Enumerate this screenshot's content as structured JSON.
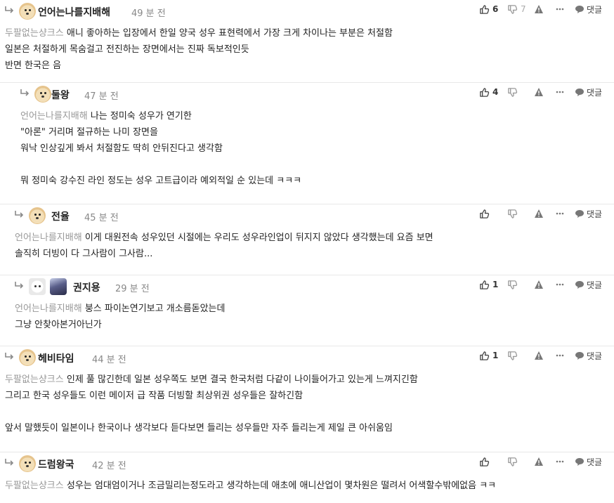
{
  "comments": [
    {
      "nickname": "언어는나를지배해",
      "time": "49 분 전",
      "likes": "6",
      "dislikes": "7",
      "mention": "두팔없는샹크스",
      "lines": [
        "애니 좋아하는 입장에서 한일 양국 성우 표현력에서 가장 크게 차이나는 부분은 처절함",
        "일본은 처절하게 목숨걸고 전진하는 장면에서는 진짜 독보적인듯",
        "반면 한국은 음"
      ]
    },
    {
      "nickname": "둘왕",
      "time": "47 분 전",
      "likes": "4",
      "dislikes": "",
      "mention": "언어는나를지배해",
      "lines": [
        "나는 정미숙 성우가 연기한",
        "\"아론\" 거리며 절규하는 나미 장면을",
        "워낙 인상깊게 봐서 처절함도 딱히 안뒤진다고 생각함",
        "",
        "뭐 정미숙 강수진 라인 정도는 성우 고트급이라 예외적일 순 있는데 ㅋㅋㅋ"
      ]
    },
    {
      "nickname": "전율",
      "time": "45 분 전",
      "likes": "",
      "dislikes": "",
      "mention": "언어는나를지배해",
      "lines": [
        "이게 대원전속 성우있던 시절에는 우리도 성우라인업이 뒤지지 않았다 생각했는데 요즘 보면",
        "솔직히 더빙이 다 그사람이 그사람..."
      ]
    },
    {
      "nickname": "권지용",
      "time": "29 분 전",
      "likes": "1",
      "dislikes": "",
      "mention": "언어는나를지배해",
      "lines": [
        "붕스 파이논연기보고 개소름돋았는데",
        "그냥 안찾아본거아닌가"
      ]
    },
    {
      "nickname": "헤비타임",
      "time": "44 분 전",
      "likes": "1",
      "dislikes": "",
      "mention": "두팔없는샹크스",
      "lines": [
        "인제 풀 많긴한데 일본 성우쪽도 보면 결국 한국처럼 다같이 나이들어가고 있는게 느껴지긴함",
        "그리고 한국 성우들도 이런 메이저 급 작품 더빙할 최상위권 성우들은 잘하긴함",
        "",
        "앞서 말했듯이 일본이나 한국이나 생각보다 듣다보면 들리는 성우들만 자주 들리는게 제일 큰 아쉬움임"
      ]
    },
    {
      "nickname": "드럼왕국",
      "time": "42 분 전",
      "likes": "",
      "dislikes": "",
      "mention": "두팔없는샹크스",
      "lines": [
        "성우는 엄대엄이거나 조금밀리는정도라고 생각하는데 애초에 애니산업이 몇차원은 떨려서 어색할수밖에없음 ㅋㅋ"
      ]
    }
  ],
  "reply_label": "댓글",
  "icons": [
    "reply-arrow-icon",
    "thumbs-up-icon",
    "thumbs-down-icon",
    "report-icon",
    "more-icon",
    "speech-bubble-icon"
  ]
}
